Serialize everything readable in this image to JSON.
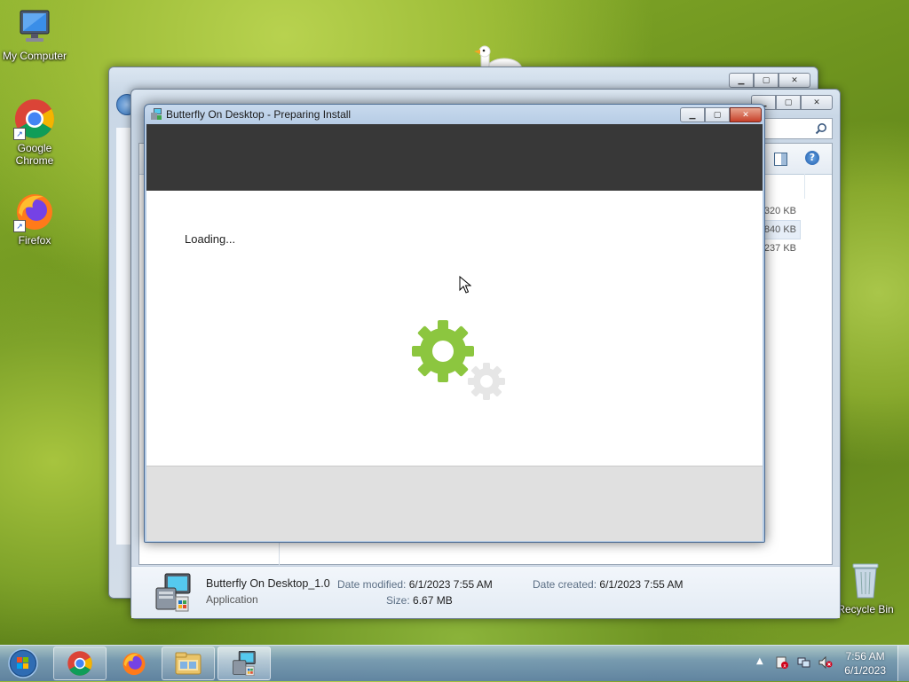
{
  "desktop": {
    "icons": [
      {
        "label": "My Computer"
      },
      {
        "label": "Google Chrome"
      },
      {
        "label": "Firefox"
      },
      {
        "label": "Recycle Bin"
      }
    ]
  },
  "explorer": {
    "file_sizes": [
      "320 KB",
      "840 KB",
      "237 KB"
    ],
    "details": {
      "name": "Butterfly On Desktop_1.0",
      "type": "Application",
      "modified_label": "Date modified:",
      "modified_value": "6/1/2023 7:55 AM",
      "size_label": "Size:",
      "size_value": "6.67 MB",
      "created_label": "Date created:",
      "created_value": "6/1/2023 7:55 AM"
    }
  },
  "installer": {
    "title": "Butterfly On Desktop - Preparing Install",
    "status": "Loading...",
    "colors": {
      "header": "#383838",
      "gear_primary": "#8cc63f",
      "gear_secondary": "#e6e6e6"
    }
  },
  "taskbar": {
    "time": "7:56 AM",
    "date": "6/1/2023"
  }
}
